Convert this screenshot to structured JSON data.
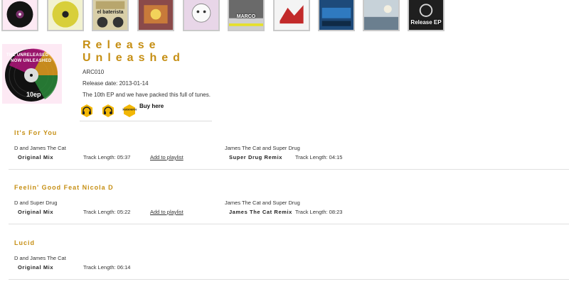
{
  "releases_strip": [
    {
      "name": "thumb-release-10ep",
      "caption": "",
      "bg": "#7a2f6b"
    },
    {
      "name": "thumb-release-2",
      "caption": "",
      "bg": "#d8cf3a"
    },
    {
      "name": "thumb-release-el-baterista",
      "caption": "el baterista",
      "bg": "#b8a66d"
    },
    {
      "name": "thumb-release-4",
      "caption": "",
      "bg": "#8a4a4a"
    },
    {
      "name": "thumb-release-5",
      "caption": "",
      "bg": "#e8d6e8"
    },
    {
      "name": "thumb-release-marco",
      "caption": "MARCO",
      "bg": "#4a4a4a"
    },
    {
      "name": "thumb-release-7",
      "caption": "",
      "bg": "#c22a2a"
    },
    {
      "name": "thumb-release-digital",
      "caption": "",
      "bg": "#1d4a7a"
    },
    {
      "name": "thumb-release-9",
      "caption": "",
      "bg": "#6b7f8f"
    },
    {
      "name": "thumb-release-ep",
      "caption": "Release EP",
      "bg": "#1f1f1f"
    }
  ],
  "release": {
    "title": "Release Unleashed",
    "cat_no": "ARC010",
    "release_date": "Release date: 2013-01-14",
    "description": "The 10th EP and we have packed this full of tunes.",
    "buy_label": "Buy here",
    "cover_text_top": "THE UNRELEASED",
    "cover_text_mid": "NOW UNLEASHED",
    "cover_badge": "10ep",
    "shop_icons": [
      "headphones-shop-icon",
      "headphones-shop-icon",
      "traxsource-shop-icon"
    ],
    "traxsource_text": "traxsource"
  },
  "tracks": [
    {
      "title": "It's For You",
      "versions": [
        {
          "artist": "D and James The Cat",
          "mix": "Original Mix",
          "length": "Track Length: 05:37",
          "add": "Add to playlist"
        },
        {
          "artist": "James The Cat and Super Drug",
          "mix": "Super Drug Remix",
          "length": "Track Length: 04:15",
          "add": ""
        }
      ]
    },
    {
      "title": "Feelin' Good Feat Nicola D",
      "versions": [
        {
          "artist": "D and Super Drug",
          "mix": "Original Mix",
          "length": "Track Length: 05:22",
          "add": "Add to playlist"
        },
        {
          "artist": "James The Cat and Super Drug",
          "mix": "James The Cat Remix",
          "length": "Track Length: 08:23",
          "add": ""
        }
      ]
    },
    {
      "title": "Lucid",
      "versions": [
        {
          "artist": "D and James The Cat",
          "mix": "Original Mix",
          "length": "Track Length: 06:14",
          "add": ""
        }
      ]
    }
  ],
  "colors": {
    "accent": "#c68f14",
    "separator": "#e0e0e0",
    "icon_yellow": "#f2b705"
  }
}
